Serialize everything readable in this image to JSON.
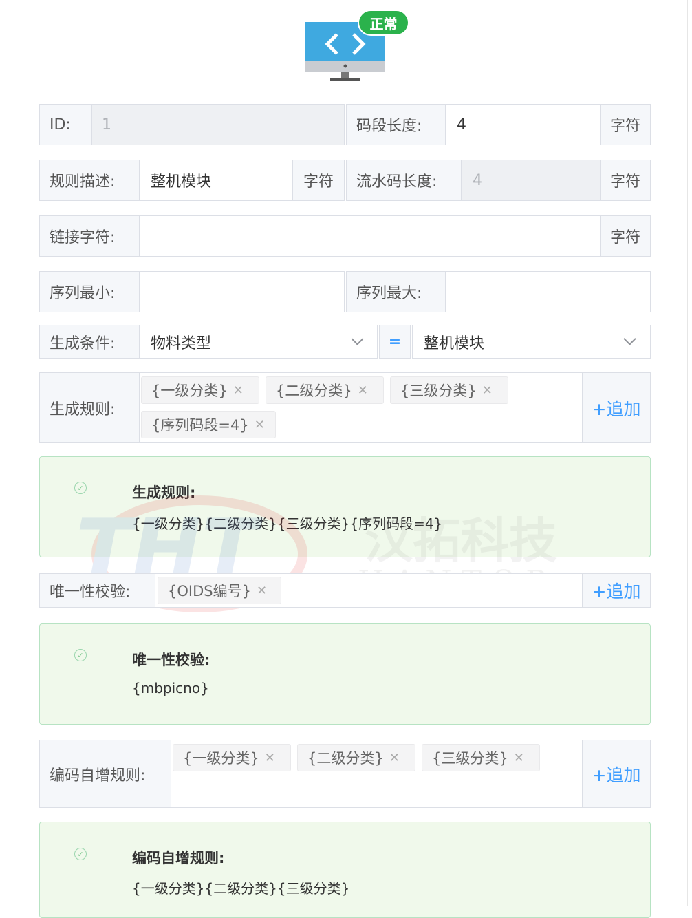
{
  "header": {
    "status_badge": "正常",
    "icon": "monitor-code-icon"
  },
  "row1": {
    "id_label": "ID:",
    "id_value": "1",
    "seg_len_label": "码段长度:",
    "seg_len_value": "4",
    "seg_len_suffix": "字符"
  },
  "row2": {
    "desc_label": "规则描述:",
    "desc_value": "整机模块",
    "desc_suffix": "字符",
    "serial_len_label": "流水码长度:",
    "serial_len_value": "4",
    "serial_len_suffix": "字符"
  },
  "row3": {
    "link_label": "链接字符:",
    "link_value": "",
    "link_suffix": "字符"
  },
  "row4": {
    "min_label": "序列最小:",
    "min_value": "",
    "max_label": "序列最大:",
    "max_value": ""
  },
  "row5": {
    "cond_label": "生成条件:",
    "cond_field": "物料类型",
    "eq": "=",
    "cond_value": "整机模块"
  },
  "gen_rule": {
    "label": "生成规则:",
    "tags": [
      "{一级分类}",
      "{二级分类}",
      "{三级分类}",
      "{序列码段=4}"
    ],
    "add": "+追加",
    "alert_title": "生成规则:",
    "alert_text": "{一级分类}{二级分类}{三级分类}{序列码段=4}"
  },
  "unique": {
    "label": "唯一性校验:",
    "tags": [
      "{OIDS编号}"
    ],
    "add": "+追加",
    "alert_title": "唯一性校验:",
    "alert_text": "{mbpicno}"
  },
  "inc_rule": {
    "label": "编码自增规则:",
    "tags": [
      "{一级分类}",
      "{二级分类}",
      "{三级分类}"
    ],
    "add": "+追加",
    "alert_title": "编码自增规则:",
    "alert_text": "{一级分类}{二级分类}{三级分类}"
  },
  "watermark": {
    "logo": "THT",
    "cn": "汉拓科技",
    "en": "HANTOP"
  },
  "colors": {
    "accent": "#409eff",
    "success_bg": "#f0f9eb",
    "badge": "#2bb24c",
    "monitor": "#3fa9e0"
  }
}
